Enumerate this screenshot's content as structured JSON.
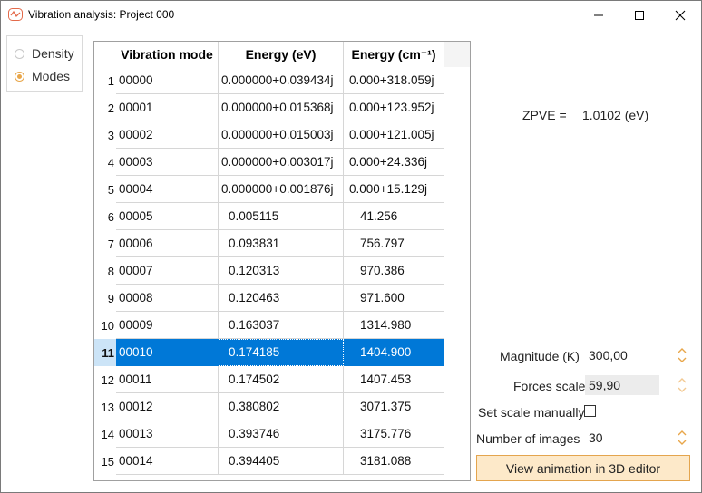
{
  "window": {
    "title": "Vibration analysis: Project 000",
    "icons": {
      "app": "app-icon",
      "minimize": "minimize-icon",
      "maximize": "maximize-icon",
      "close": "close-icon"
    }
  },
  "radio_group": {
    "options": [
      {
        "label": "Density",
        "checked": false
      },
      {
        "label": "Modes",
        "checked": true
      }
    ],
    "accent_color": "#e8a64a"
  },
  "table": {
    "headers": {
      "mode": "Vibration mode",
      "ev": "Energy (eV)",
      "cm": "Energy (cm⁻¹)"
    },
    "selected_row": 11,
    "selection_color": "#0078d7",
    "rows": [
      {
        "idx": "1",
        "mode": "00000",
        "ev": "0.000000+0.039434j",
        "cm": "0.000+318.059j"
      },
      {
        "idx": "2",
        "mode": "00001",
        "ev": "0.000000+0.015368j",
        "cm": "0.000+123.952j"
      },
      {
        "idx": "3",
        "mode": "00002",
        "ev": "0.000000+0.015003j",
        "cm": "0.000+121.005j"
      },
      {
        "idx": "4",
        "mode": "00003",
        "ev": "0.000000+0.003017j",
        "cm": "0.000+24.336j"
      },
      {
        "idx": "5",
        "mode": "00004",
        "ev": "0.000000+0.001876j",
        "cm": "0.000+15.129j"
      },
      {
        "idx": "6",
        "mode": "00005",
        "ev": "0.005115",
        "cm": "41.256"
      },
      {
        "idx": "7",
        "mode": "00006",
        "ev": "0.093831",
        "cm": "756.797"
      },
      {
        "idx": "8",
        "mode": "00007",
        "ev": "0.120313",
        "cm": "970.386"
      },
      {
        "idx": "9",
        "mode": "00008",
        "ev": "0.120463",
        "cm": "971.600"
      },
      {
        "idx": "10",
        "mode": "00009",
        "ev": "0.163037",
        "cm": "1314.980"
      },
      {
        "idx": "11",
        "mode": "00010",
        "ev": "0.174185",
        "cm": "1404.900"
      },
      {
        "idx": "12",
        "mode": "00011",
        "ev": "0.174502",
        "cm": "1407.453"
      },
      {
        "idx": "13",
        "mode": "00012",
        "ev": "0.380802",
        "cm": "3071.375"
      },
      {
        "idx": "14",
        "mode": "00013",
        "ev": "0.393746",
        "cm": "3175.776"
      },
      {
        "idx": "15",
        "mode": "00014",
        "ev": "0.394405",
        "cm": "3181.088"
      }
    ]
  },
  "zpve": {
    "label": "ZPVE =",
    "value": "1.0102 (eV)"
  },
  "controls": {
    "magnitude": {
      "label": "Magnitude (K)",
      "value": "300,00"
    },
    "forces_scale": {
      "label": "Forces scale",
      "value": "59,90"
    },
    "set_scale_manually": {
      "label": "Set scale manually",
      "checked": false
    },
    "num_images": {
      "label": "Number of images",
      "value": "30"
    },
    "view_button": "View animation in 3D editor",
    "spin_color": "#e8a64a"
  }
}
